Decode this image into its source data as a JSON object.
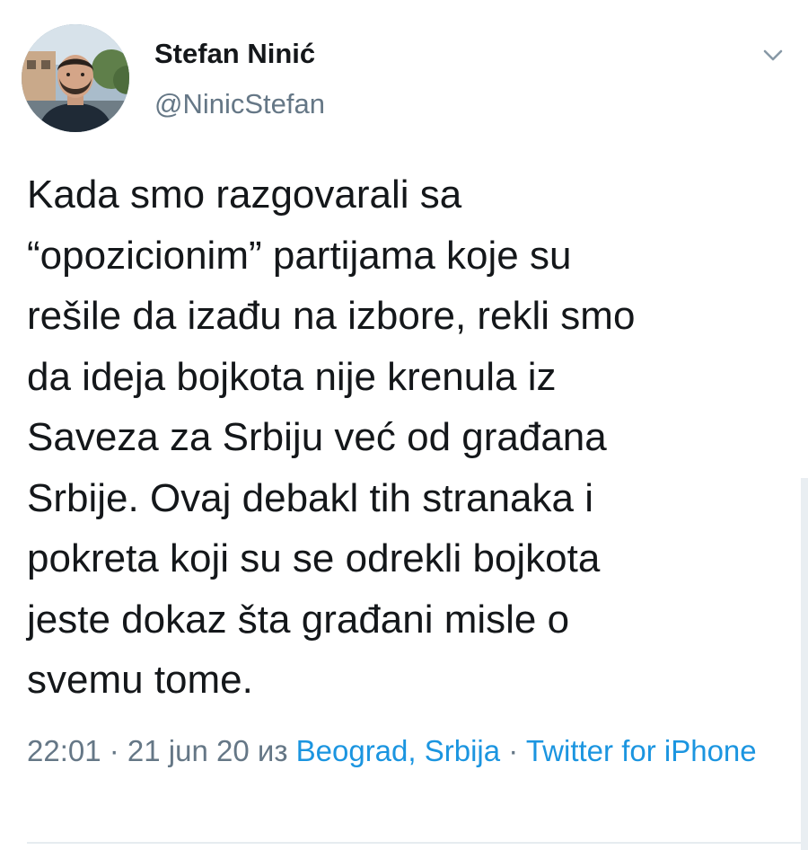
{
  "author": {
    "name": "Stefan Ninić",
    "handle": "@NinicStefan"
  },
  "tweet": {
    "text": "Kada smo razgovarali sa\n“opozicionim” partijama koje su\nrešile da izađu na izbore, rekli smo\nda ideja bojkota nije krenula iz\nSaveza za Srbiju već od građana\nSrbije. Ovaj debakl tih stranaka i\npokreta koji su se odrekli bojkota\njeste dokaz šta građani misle o\nsvemu tome."
  },
  "meta": {
    "time": "22:01",
    "separator1": " · ",
    "date": "21 jun 20",
    "from_word": " из ",
    "location": "Beograd, Srbija",
    "separator2": " · ",
    "source": "Twitter for iPhone"
  },
  "icons": {
    "caret": "chevron-down-icon",
    "avatar": "user-avatar"
  },
  "colors": {
    "text": "#14171a",
    "secondary": "#657786",
    "link": "#1b95e0"
  }
}
